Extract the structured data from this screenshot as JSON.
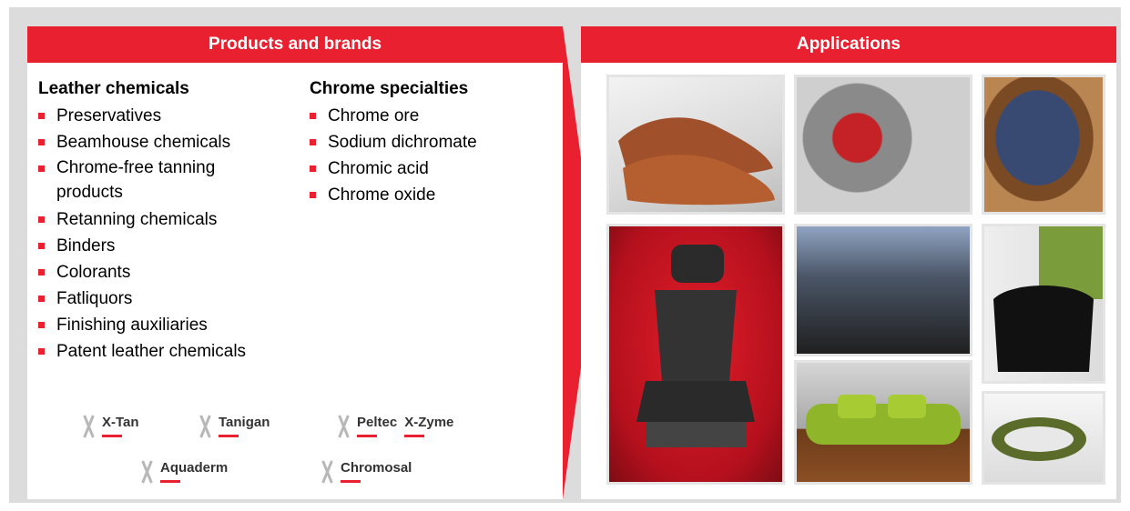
{
  "left_panel": {
    "title": "Products and brands",
    "leather": {
      "heading": "Leather chemicals",
      "items": [
        "Preservatives",
        "Beamhouse chemicals",
        "Chrome-free tanning products",
        "Retanning chemicals",
        "Binders",
        "Colorants",
        "Fatliquors",
        "Finishing auxiliaries",
        "Patent leather chemicals"
      ]
    },
    "chrome": {
      "heading": "Chrome specialties",
      "items": [
        "Chrome ore",
        "Sodium dichromate",
        "Chromic acid",
        "Chrome oxide"
      ]
    },
    "brands": [
      "X-Tan",
      "Tanigan",
      "Peltec",
      "X-Zyme",
      "Aquaderm",
      "Chromosal"
    ]
  },
  "right_panel": {
    "title": "Applications"
  },
  "colors": {
    "accent": "#e8202f",
    "frame": "#dcdcdc"
  },
  "icons": {
    "brand_mark": "x-logo-icon",
    "arrow": "chevron-right-icon"
  }
}
